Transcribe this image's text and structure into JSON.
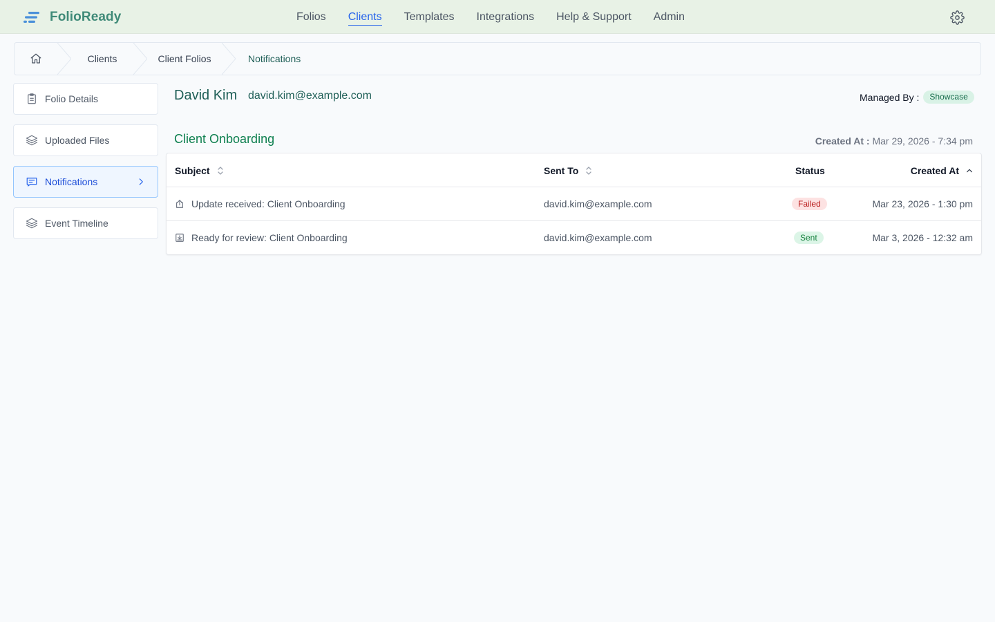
{
  "app": {
    "name": "FolioReady",
    "colors": {
      "brand": "#3f8a78",
      "accent": "#2563eb",
      "topbar_bg": "#e8f2e6"
    }
  },
  "nav": {
    "items": [
      {
        "label": "Folios"
      },
      {
        "label": "Clients",
        "active": true
      },
      {
        "label": "Templates"
      },
      {
        "label": "Integrations"
      },
      {
        "label": "Help & Support"
      },
      {
        "label": "Admin"
      }
    ],
    "settings_icon": "gear-icon"
  },
  "breadcrumb": {
    "home_icon": "home-icon",
    "items": [
      "Clients",
      "Client Folios",
      "Notifications"
    ]
  },
  "sidebar": {
    "items": [
      {
        "label": "Folio Details",
        "icon": "clipboard-icon"
      },
      {
        "label": "Uploaded Files",
        "icon": "layers-icon"
      },
      {
        "label": "Notifications",
        "icon": "message-icon",
        "active": true
      },
      {
        "label": "Event Timeline",
        "icon": "layers-icon"
      }
    ]
  },
  "client": {
    "name": "David Kim",
    "email": "david.kim@example.com",
    "managed_by_label": "Managed By :",
    "managed_by_value": "Showcase"
  },
  "folio": {
    "title": "Client Onboarding",
    "created_label": "Created At :",
    "created_value": "Mar 29, 2026 - 7:34 pm"
  },
  "table": {
    "columns": {
      "subject": "Subject",
      "sent_to": "Sent To",
      "status": "Status",
      "created_at": "Created At"
    },
    "rows": [
      {
        "icon": "upload-icon",
        "subject": "Update received: Client Onboarding",
        "sent_to": "david.kim@example.com",
        "status": "Failed",
        "created_at": "Mar 23, 2026 - 1:30 pm"
      },
      {
        "icon": "inbox-download-icon",
        "subject": "Ready for review: Client Onboarding",
        "sent_to": "david.kim@example.com",
        "status": "Sent",
        "created_at": "Mar 3, 2026 - 12:32 am"
      }
    ],
    "status_colors": {
      "Failed": "#b91c1c",
      "Sent": "#15803d"
    }
  }
}
